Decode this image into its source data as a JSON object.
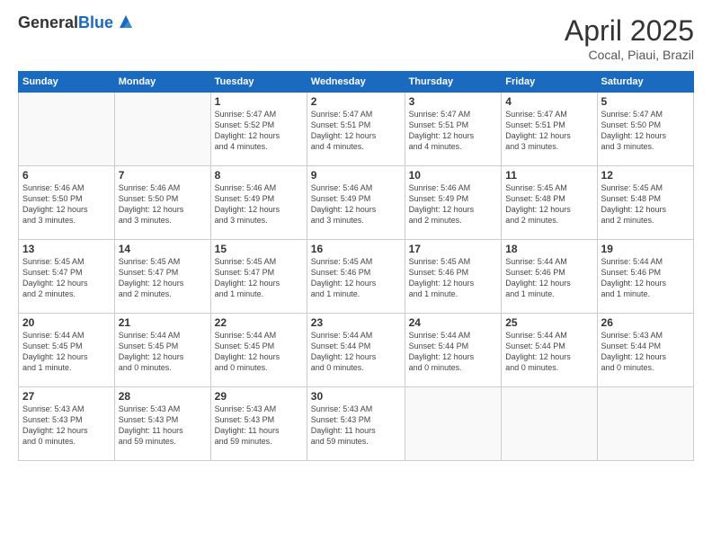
{
  "header": {
    "logo_general": "General",
    "logo_blue": "Blue",
    "month_year": "April 2025",
    "location": "Cocal, Piaui, Brazil"
  },
  "weekdays": [
    "Sunday",
    "Monday",
    "Tuesday",
    "Wednesday",
    "Thursday",
    "Friday",
    "Saturday"
  ],
  "weeks": [
    [
      {
        "day": "",
        "content": ""
      },
      {
        "day": "",
        "content": ""
      },
      {
        "day": "1",
        "content": "Sunrise: 5:47 AM\nSunset: 5:52 PM\nDaylight: 12 hours\nand 4 minutes."
      },
      {
        "day": "2",
        "content": "Sunrise: 5:47 AM\nSunset: 5:51 PM\nDaylight: 12 hours\nand 4 minutes."
      },
      {
        "day": "3",
        "content": "Sunrise: 5:47 AM\nSunset: 5:51 PM\nDaylight: 12 hours\nand 4 minutes."
      },
      {
        "day": "4",
        "content": "Sunrise: 5:47 AM\nSunset: 5:51 PM\nDaylight: 12 hours\nand 3 minutes."
      },
      {
        "day": "5",
        "content": "Sunrise: 5:47 AM\nSunset: 5:50 PM\nDaylight: 12 hours\nand 3 minutes."
      }
    ],
    [
      {
        "day": "6",
        "content": "Sunrise: 5:46 AM\nSunset: 5:50 PM\nDaylight: 12 hours\nand 3 minutes."
      },
      {
        "day": "7",
        "content": "Sunrise: 5:46 AM\nSunset: 5:50 PM\nDaylight: 12 hours\nand 3 minutes."
      },
      {
        "day": "8",
        "content": "Sunrise: 5:46 AM\nSunset: 5:49 PM\nDaylight: 12 hours\nand 3 minutes."
      },
      {
        "day": "9",
        "content": "Sunrise: 5:46 AM\nSunset: 5:49 PM\nDaylight: 12 hours\nand 3 minutes."
      },
      {
        "day": "10",
        "content": "Sunrise: 5:46 AM\nSunset: 5:49 PM\nDaylight: 12 hours\nand 2 minutes."
      },
      {
        "day": "11",
        "content": "Sunrise: 5:45 AM\nSunset: 5:48 PM\nDaylight: 12 hours\nand 2 minutes."
      },
      {
        "day": "12",
        "content": "Sunrise: 5:45 AM\nSunset: 5:48 PM\nDaylight: 12 hours\nand 2 minutes."
      }
    ],
    [
      {
        "day": "13",
        "content": "Sunrise: 5:45 AM\nSunset: 5:47 PM\nDaylight: 12 hours\nand 2 minutes."
      },
      {
        "day": "14",
        "content": "Sunrise: 5:45 AM\nSunset: 5:47 PM\nDaylight: 12 hours\nand 2 minutes."
      },
      {
        "day": "15",
        "content": "Sunrise: 5:45 AM\nSunset: 5:47 PM\nDaylight: 12 hours\nand 1 minute."
      },
      {
        "day": "16",
        "content": "Sunrise: 5:45 AM\nSunset: 5:46 PM\nDaylight: 12 hours\nand 1 minute."
      },
      {
        "day": "17",
        "content": "Sunrise: 5:45 AM\nSunset: 5:46 PM\nDaylight: 12 hours\nand 1 minute."
      },
      {
        "day": "18",
        "content": "Sunrise: 5:44 AM\nSunset: 5:46 PM\nDaylight: 12 hours\nand 1 minute."
      },
      {
        "day": "19",
        "content": "Sunrise: 5:44 AM\nSunset: 5:46 PM\nDaylight: 12 hours\nand 1 minute."
      }
    ],
    [
      {
        "day": "20",
        "content": "Sunrise: 5:44 AM\nSunset: 5:45 PM\nDaylight: 12 hours\nand 1 minute."
      },
      {
        "day": "21",
        "content": "Sunrise: 5:44 AM\nSunset: 5:45 PM\nDaylight: 12 hours\nand 0 minutes."
      },
      {
        "day": "22",
        "content": "Sunrise: 5:44 AM\nSunset: 5:45 PM\nDaylight: 12 hours\nand 0 minutes."
      },
      {
        "day": "23",
        "content": "Sunrise: 5:44 AM\nSunset: 5:44 PM\nDaylight: 12 hours\nand 0 minutes."
      },
      {
        "day": "24",
        "content": "Sunrise: 5:44 AM\nSunset: 5:44 PM\nDaylight: 12 hours\nand 0 minutes."
      },
      {
        "day": "25",
        "content": "Sunrise: 5:44 AM\nSunset: 5:44 PM\nDaylight: 12 hours\nand 0 minutes."
      },
      {
        "day": "26",
        "content": "Sunrise: 5:43 AM\nSunset: 5:44 PM\nDaylight: 12 hours\nand 0 minutes."
      }
    ],
    [
      {
        "day": "27",
        "content": "Sunrise: 5:43 AM\nSunset: 5:43 PM\nDaylight: 12 hours\nand 0 minutes."
      },
      {
        "day": "28",
        "content": "Sunrise: 5:43 AM\nSunset: 5:43 PM\nDaylight: 11 hours\nand 59 minutes."
      },
      {
        "day": "29",
        "content": "Sunrise: 5:43 AM\nSunset: 5:43 PM\nDaylight: 11 hours\nand 59 minutes."
      },
      {
        "day": "30",
        "content": "Sunrise: 5:43 AM\nSunset: 5:43 PM\nDaylight: 11 hours\nand 59 minutes."
      },
      {
        "day": "",
        "content": ""
      },
      {
        "day": "",
        "content": ""
      },
      {
        "day": "",
        "content": ""
      }
    ]
  ]
}
